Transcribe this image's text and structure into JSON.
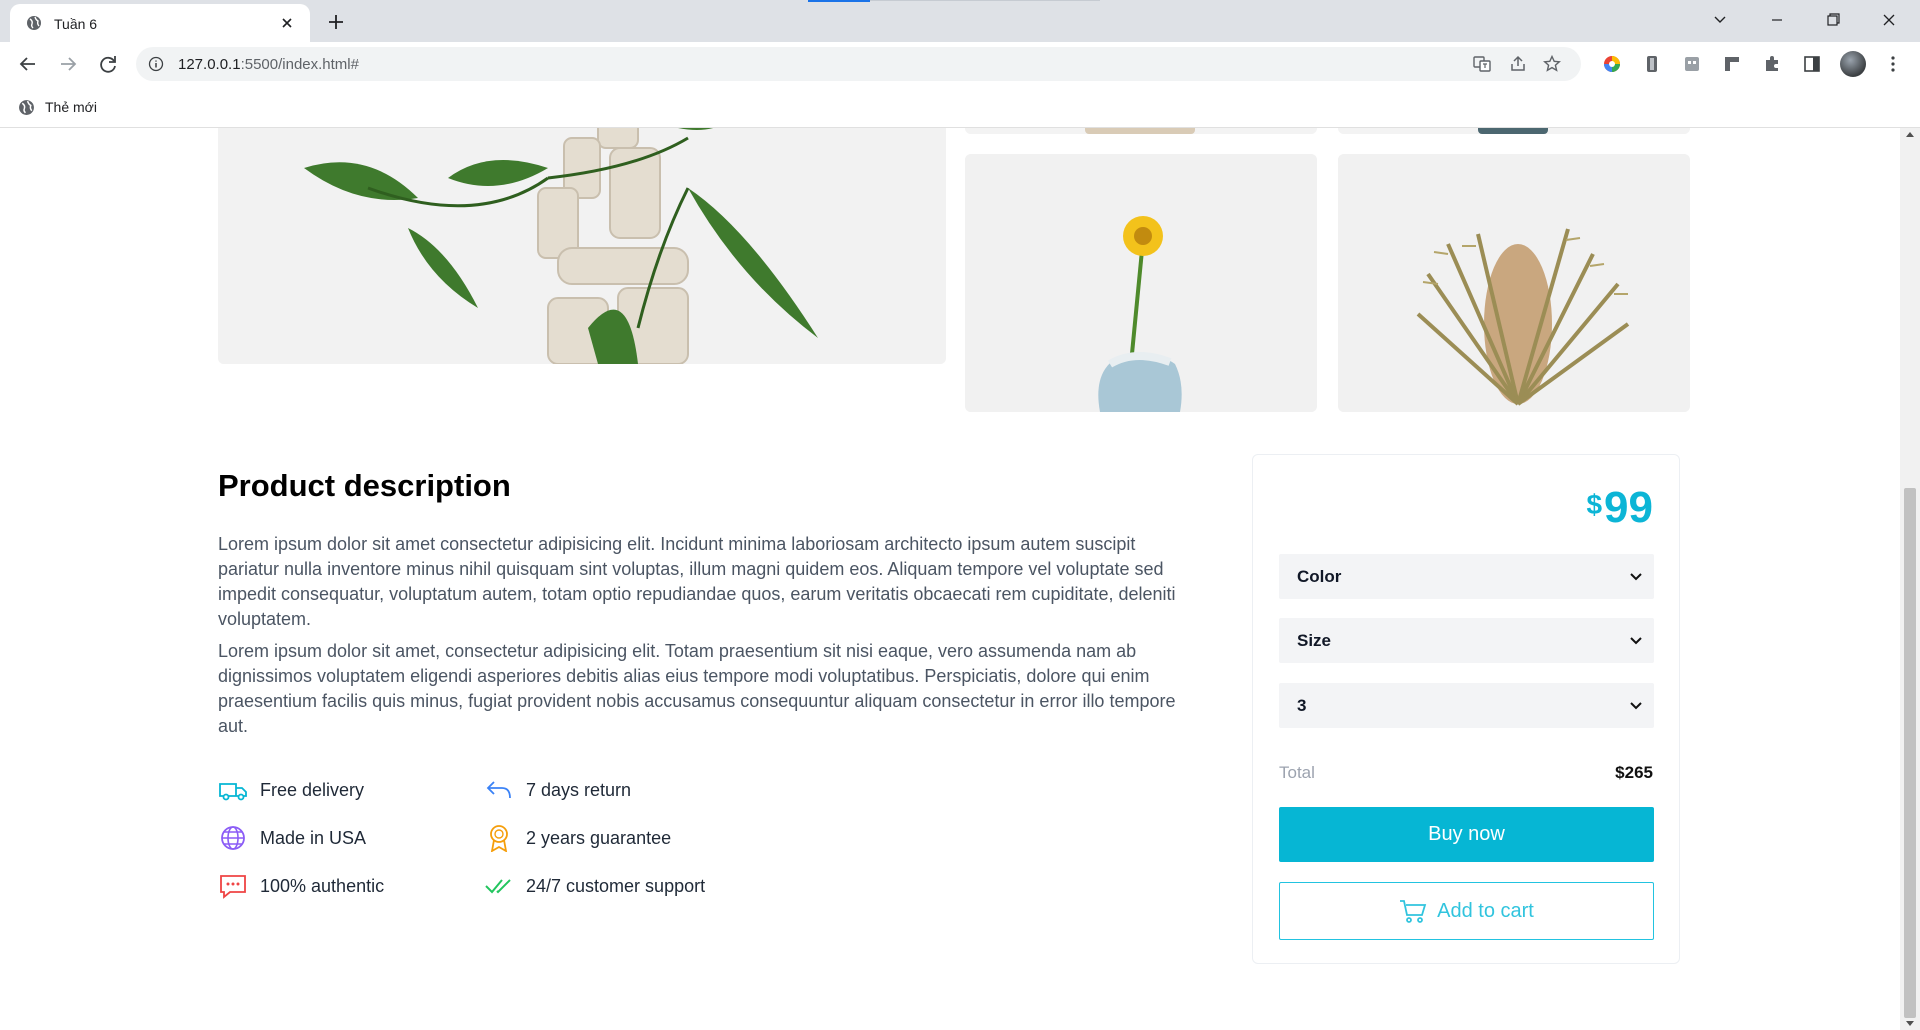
{
  "browser": {
    "tab_title": "Tuần 6",
    "url_host": "127.0.0.1",
    "url_rest": ":5500/index.html#",
    "bookmark_label": "Thẻ mới"
  },
  "description": {
    "title": "Product description",
    "paragraph1": "Lorem ipsum dolor sit amet consectetur adipisicing elit. Incidunt minima laboriosam architecto ipsum autem suscipit pariatur nulla inventore minus nihil quisquam sint voluptas, illum magni quidem eos. Aliquam tempore vel voluptate sed impedit consequatur, voluptatum autem, totam optio repudiandae quos, earum veritatis obcaecati rem cupiditate, deleniti voluptatem.",
    "paragraph2": "Lorem ipsum dolor sit amet, consectetur adipisicing elit. Totam praesentium sit nisi eaque, vero assumenda nam ab dignissimos voluptatem eligendi asperiores debitis alias eius tempore modi voluptatibus. Perspiciatis, dolore qui enim praesentium facilis quis minus, fugiat provident nobis accusamus consequuntur aliquam consectetur in error illo tempore aut."
  },
  "features": [
    {
      "label": "Free delivery",
      "icon": "truck-icon",
      "color": "#06b6d4"
    },
    {
      "label": "7 days return",
      "icon": "return-arrow-icon",
      "color": "#3b82f6"
    },
    {
      "label": "Made in USA",
      "icon": "globe-icon",
      "color": "#8b5cf6"
    },
    {
      "label": "2 years guarantee",
      "icon": "award-ribbon-icon",
      "color": "#f59e0b"
    },
    {
      "label": "100% authentic",
      "icon": "chat-bubble-icon",
      "color": "#ef4444"
    },
    {
      "label": "24/7 customer support",
      "icon": "double-check-icon",
      "color": "#22c55e"
    }
  ],
  "purchase": {
    "currency": "$",
    "price": "99",
    "color_select": "Color",
    "size_select": "Size",
    "quantity_select": "3",
    "total_label": "Total",
    "total_value": "$265",
    "buy_label": "Buy now",
    "cart_label": "Add to cart",
    "accent_color": "#06b6d4"
  }
}
